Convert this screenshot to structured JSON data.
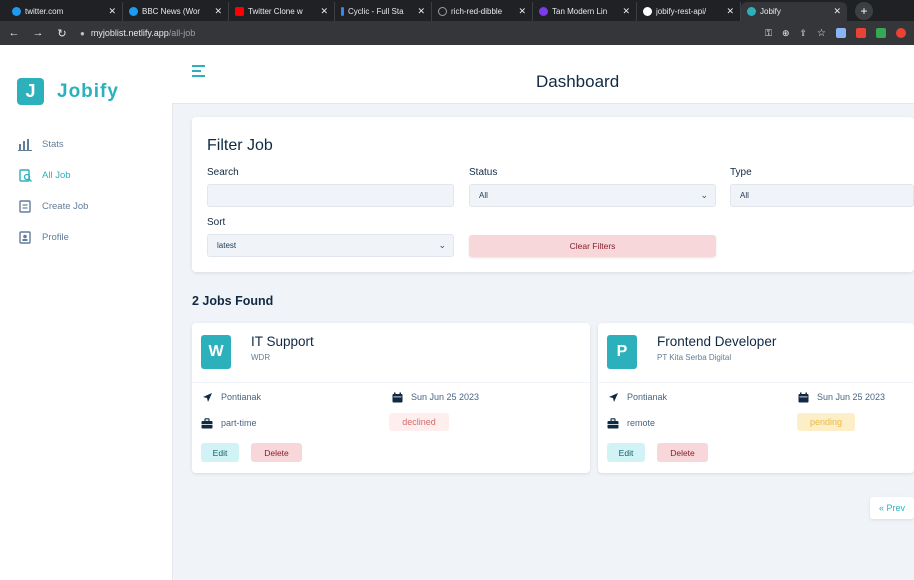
{
  "browser": {
    "tabs": [
      {
        "title": "twitter.com",
        "icon": "twitter-icon",
        "color": "#1d9bf0"
      },
      {
        "title": "BBC News (Wor",
        "icon": "twitter-icon",
        "color": "#1d9bf0"
      },
      {
        "title": "Twitter Clone w",
        "icon": "youtube-icon",
        "color": "#ff0000"
      },
      {
        "title": "Cyclic - Full Sta",
        "icon": "cyclic-icon",
        "color": "#3b82f6"
      },
      {
        "title": "rich-red-dibble",
        "icon": "globe-icon",
        "color": "#9aa0a6"
      },
      {
        "title": "Tan Modern Lin",
        "icon": "canva-icon",
        "color": "#7c3aed"
      },
      {
        "title": "jobify-rest-api/",
        "icon": "github-icon",
        "color": "#ffffff"
      },
      {
        "title": "Jobify",
        "icon": "jobify-icon",
        "color": "#2cb1bc"
      }
    ],
    "url_host": "myjoblist.netlify.app",
    "url_path": "/all-job"
  },
  "brand": {
    "logo_letter": "J",
    "name": "Jobify",
    "accent": "#2cb1bc"
  },
  "sidebar": {
    "items": [
      {
        "label": "Stats",
        "icon": "stats-icon"
      },
      {
        "label": "All Job",
        "icon": "all-jobs-icon"
      },
      {
        "label": "Create Job",
        "icon": "create-job-icon"
      },
      {
        "label": "Profile",
        "icon": "profile-icon"
      }
    ]
  },
  "header": {
    "title": "Dashboard"
  },
  "filter": {
    "title": "Filter Job",
    "search_label": "Search",
    "search_value": "",
    "status_label": "Status",
    "status_value": "All",
    "type_label": "Type",
    "type_value": "All",
    "sort_label": "Sort",
    "sort_value": "latest",
    "clear_label": "Clear Filters"
  },
  "jobs_found": "2 Jobs Found",
  "jobs": [
    {
      "initial": "W",
      "position": "IT Support",
      "company": "WDR",
      "location": "Pontianak",
      "date": "Sun Jun 25 2023",
      "type": "part-time",
      "status": "declined",
      "status_bg": "#ffeeee",
      "status_color": "#d66a6a"
    },
    {
      "initial": "P",
      "position": "Frontend Developer",
      "company": "PT Kita Serba Digital",
      "location": "Pontianak",
      "date": "Sun Jun 25 2023",
      "type": "remote",
      "status": "pending",
      "status_bg": "#fcefc7",
      "status_color": "#e9b949"
    }
  ],
  "actions": {
    "edit_label": "Edit",
    "delete_label": "Delete"
  },
  "pagination": {
    "prev_label": "« Prev"
  }
}
